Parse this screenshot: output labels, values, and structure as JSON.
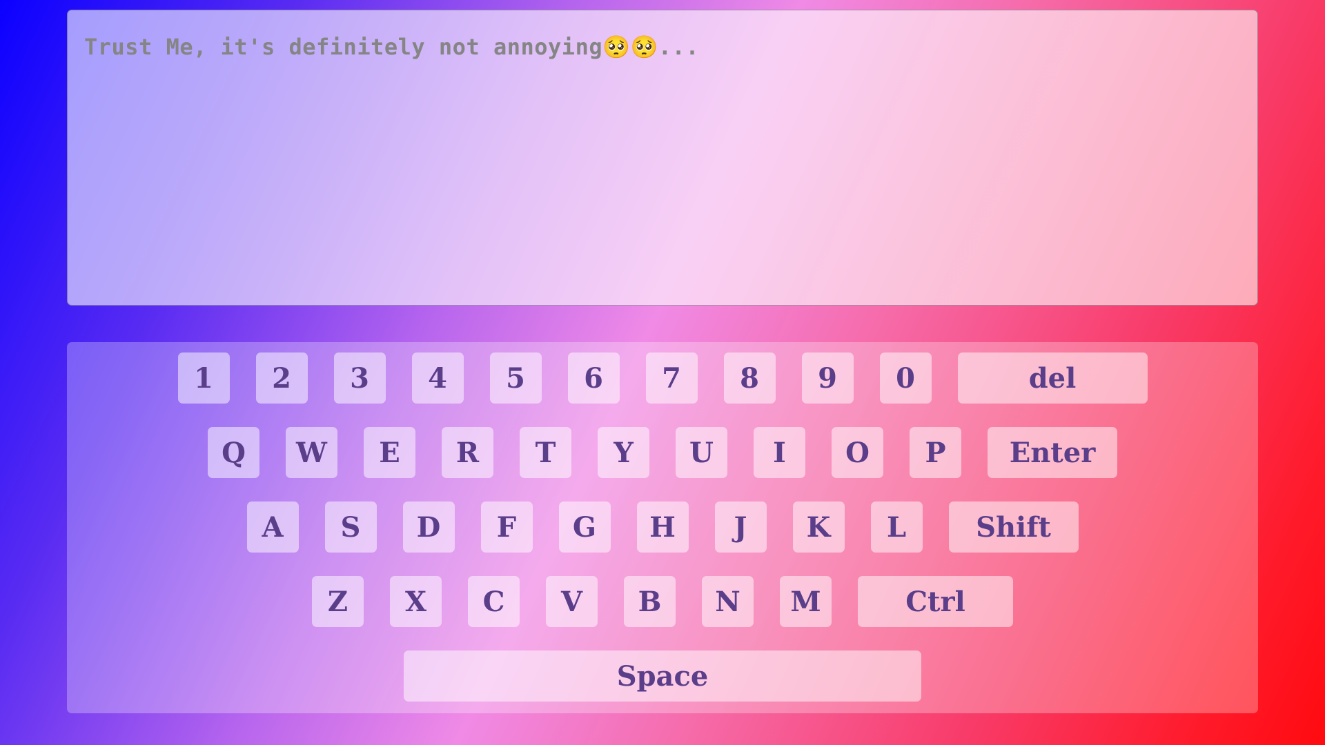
{
  "textarea": {
    "content": "Trust Me, it's definitely not annoying🥺🥺..."
  },
  "keyboard": {
    "row1": [
      "1",
      "2",
      "3",
      "4",
      "5",
      "6",
      "7",
      "8",
      "9",
      "0"
    ],
    "del_label": "del",
    "row2": [
      "Q",
      "W",
      "E",
      "R",
      "T",
      "Y",
      "U",
      "I",
      "O",
      "P"
    ],
    "enter_label": "Enter",
    "row3": [
      "A",
      "S",
      "D",
      "F",
      "G",
      "H",
      "J",
      "K",
      "L"
    ],
    "shift_label": "Shift",
    "row4": [
      "Z",
      "X",
      "C",
      "V",
      "B",
      "N",
      "M"
    ],
    "ctrl_label": "Ctrl",
    "space_label": "Space"
  },
  "colors": {
    "background_start": "#0b00ff",
    "background_mid": "#f08ae6",
    "background_end": "#ff0a10",
    "key_text": "#5a3e8a",
    "textarea_text": "#858585"
  }
}
